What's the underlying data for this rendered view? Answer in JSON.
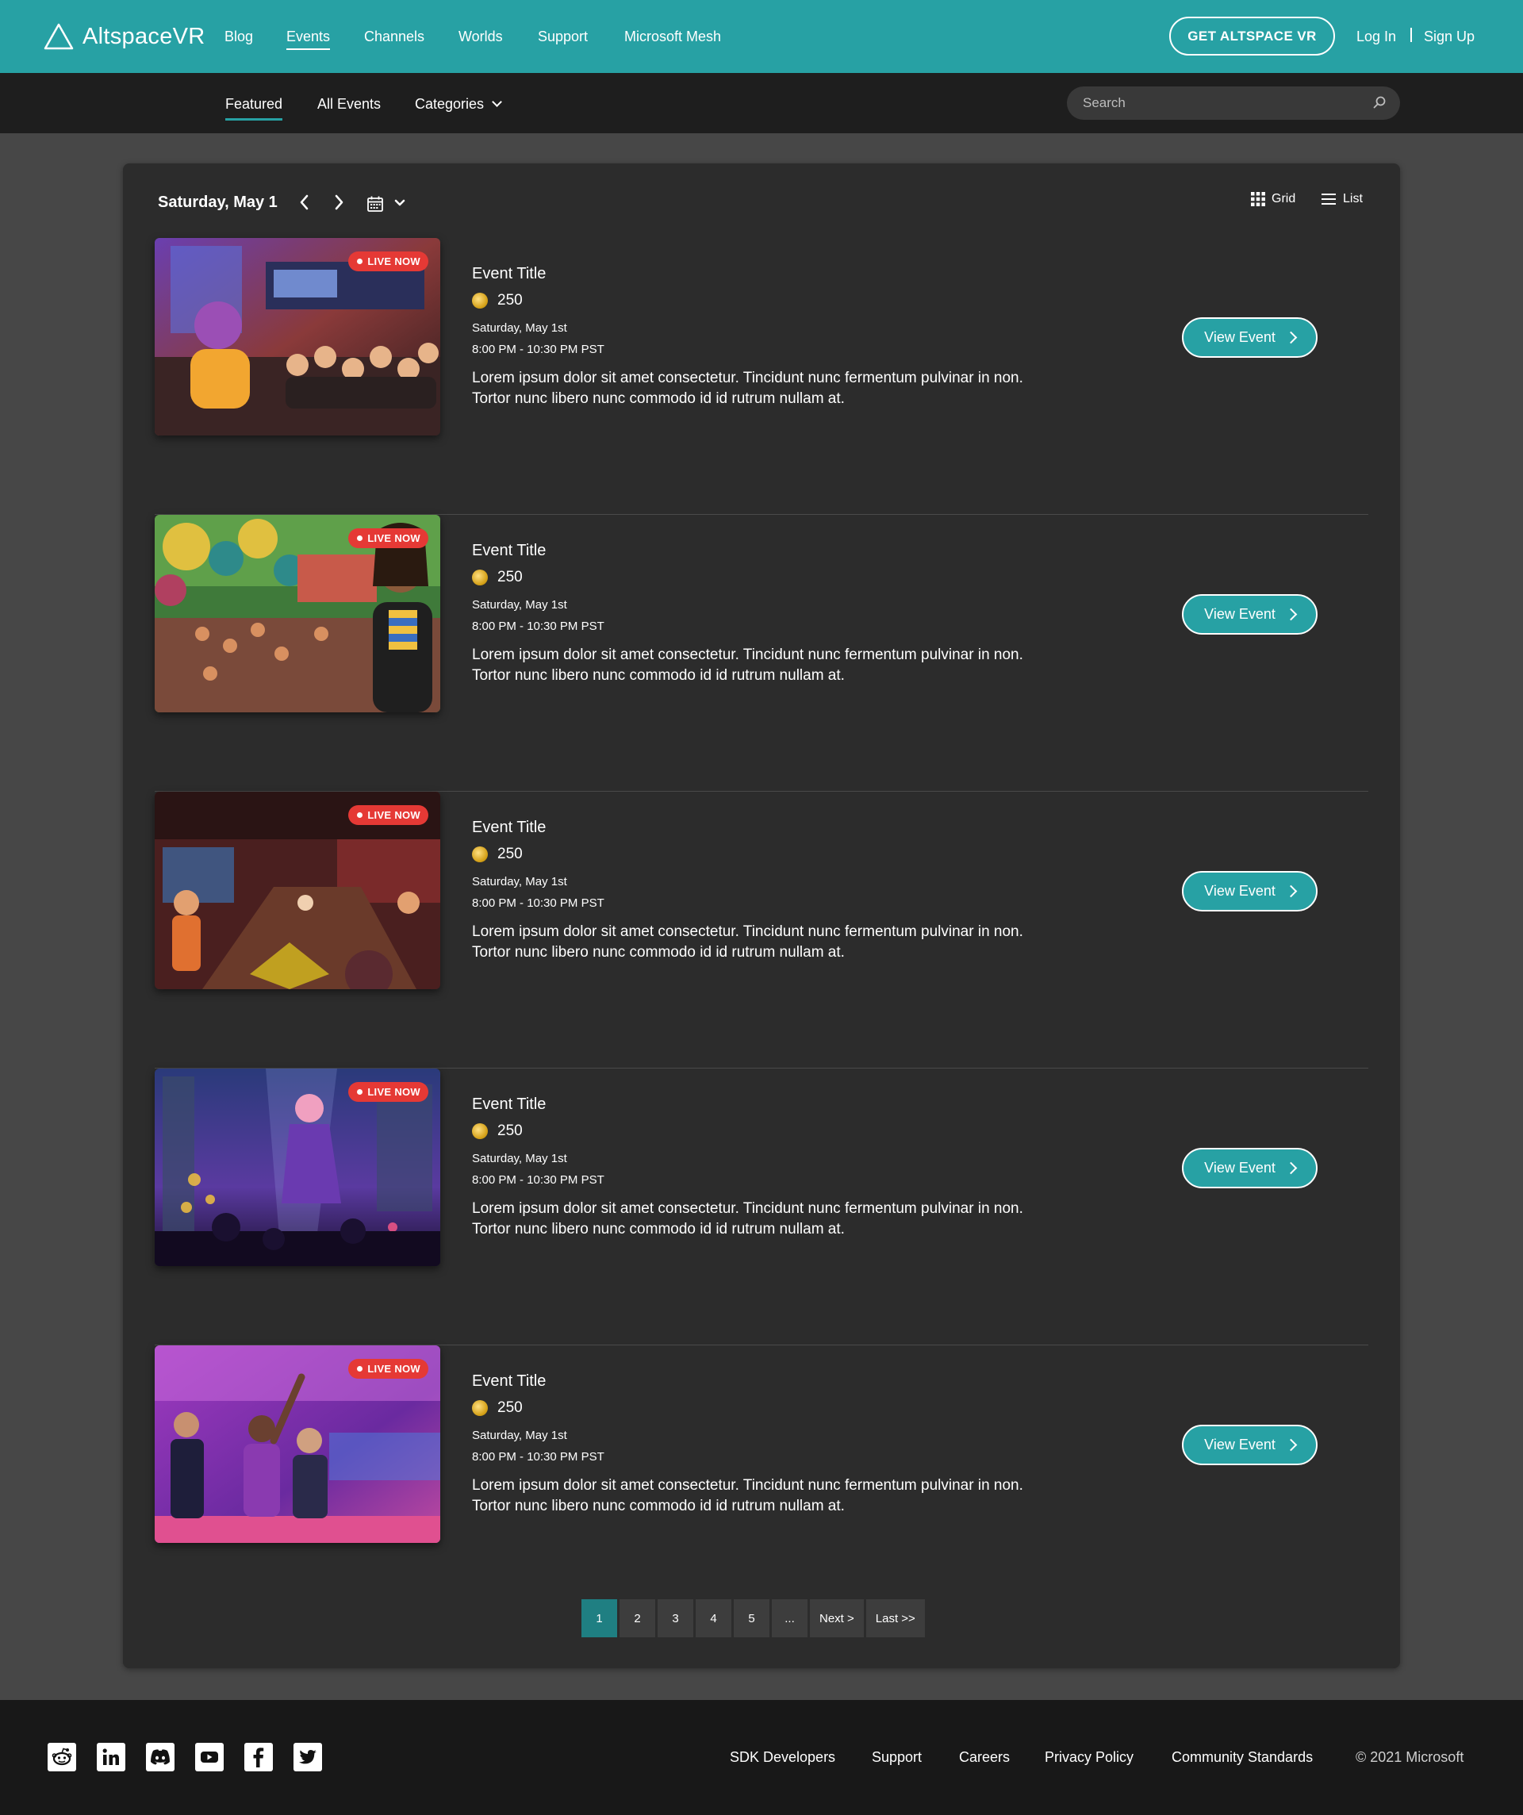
{
  "header": {
    "logo_text": "AltspaceVR",
    "nav": [
      {
        "label": "Blog",
        "active": false
      },
      {
        "label": "Events",
        "active": true
      },
      {
        "label": "Channels",
        "active": false
      },
      {
        "label": "Worlds",
        "active": false
      },
      {
        "label": "Support",
        "active": false
      },
      {
        "label": "Microsoft Mesh",
        "active": false
      }
    ],
    "cta_label": "GET ALTSPACE VR",
    "login_label": "Log In",
    "signup_label": "Sign Up",
    "brand_color": "#27a1a4"
  },
  "subnav": {
    "tabs": [
      {
        "label": "Featured",
        "active": true
      },
      {
        "label": "All Events",
        "active": false
      },
      {
        "label": "Categories",
        "active": false
      }
    ],
    "search_placeholder": "Search"
  },
  "listing": {
    "date_label": "Saturday, May 1",
    "grid_label": "Grid",
    "list_label": "List",
    "events": [
      {
        "title": "Event Title",
        "price": "250",
        "date": "Saturday, May 1st",
        "time": "8:00 PM - 10:30 PM PST",
        "description": "Lorem ipsum dolor sit amet consectetur. Tincidunt nunc fermentum pulvinar in non. Tortor nunc libero nunc commodo id id rutrum nullam at.",
        "badge": "LIVE NOW",
        "button": "View Event"
      },
      {
        "title": "Event Title",
        "price": "250",
        "date": "Saturday, May 1st",
        "time": "8:00 PM - 10:30 PM PST",
        "description": "Lorem ipsum dolor sit amet consectetur. Tincidunt nunc fermentum pulvinar in non. Tortor nunc libero nunc commodo id id rutrum nullam at.",
        "badge": "LIVE NOW",
        "button": "View Event"
      },
      {
        "title": "Event Title",
        "price": "250",
        "date": "Saturday, May 1st",
        "time": "8:00 PM - 10:30 PM PST",
        "description": "Lorem ipsum dolor sit amet consectetur. Tincidunt nunc fermentum pulvinar in non. Tortor nunc libero nunc commodo id id rutrum nullam at.",
        "badge": "LIVE NOW",
        "button": "View Event"
      },
      {
        "title": "Event Title",
        "price": "250",
        "date": "Saturday, May 1st",
        "time": "8:00 PM - 10:30 PM PST",
        "description": "Lorem ipsum dolor sit amet consectetur. Tincidunt nunc fermentum pulvinar in non. Tortor nunc libero nunc commodo id id rutrum nullam at.",
        "badge": "LIVE NOW",
        "button": "View Event"
      },
      {
        "title": "Event Title",
        "price": "250",
        "date": "Saturday, May 1st",
        "time": "8:00 PM - 10:30 PM PST",
        "description": "Lorem ipsum dolor sit amet consectetur. Tincidunt nunc fermentum pulvinar in non. Tortor nunc libero nunc commodo id id rutrum nullam at.",
        "badge": "LIVE NOW",
        "button": "View Event"
      }
    ],
    "pagination": {
      "pages": [
        "1",
        "2",
        "3",
        "4",
        "5",
        "..."
      ],
      "current": "1",
      "next_label": "Next >",
      "last_label": "Last >>"
    }
  },
  "footer": {
    "social_icons": [
      "reddit-icon",
      "linkedin-icon",
      "discord-icon",
      "youtube-icon",
      "facebook-icon",
      "twitter-icon"
    ],
    "links": [
      "SDK Developers",
      "Support",
      "Careers",
      "Privacy Policy",
      "Community Standards"
    ],
    "copyright": "© 2021 Microsoft"
  }
}
